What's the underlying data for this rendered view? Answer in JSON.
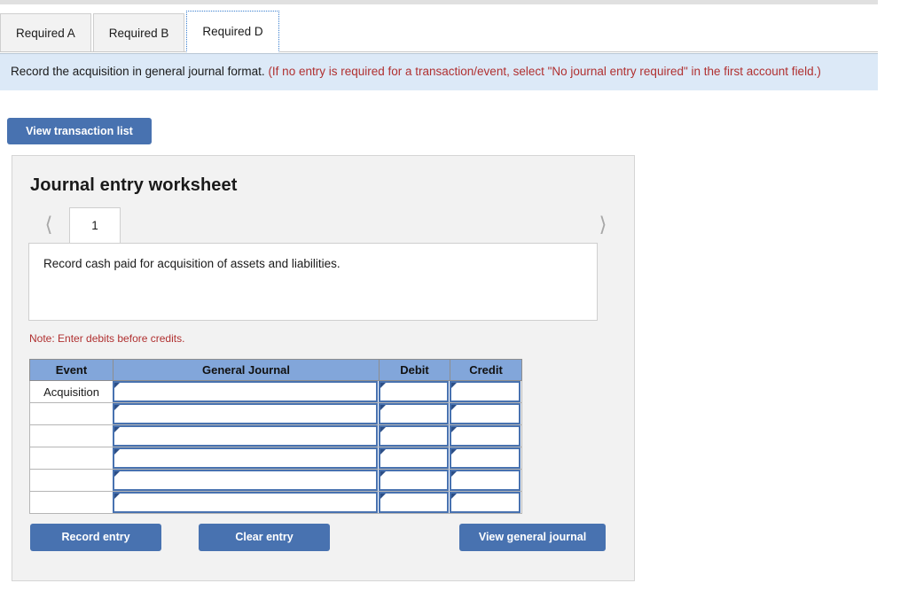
{
  "tabs": [
    {
      "label": "Required A",
      "active": false
    },
    {
      "label": "Required B",
      "active": false
    },
    {
      "label": "Required D",
      "active": true
    }
  ],
  "instruction": {
    "main": "Record the acquisition in general journal format.",
    "hint": "(If no entry is required for a transaction/event, select \"No journal entry required\" in the first account field.)"
  },
  "toolbar": {
    "view_transaction_list_label": "View transaction list"
  },
  "worksheet": {
    "title": "Journal entry worksheet",
    "pager": {
      "prev_icon": "chevron-left-icon",
      "next_icon": "chevron-right-icon",
      "current_page": "1"
    },
    "description": "Record cash paid for acquisition of assets and liabilities.",
    "note": "Note: Enter debits before credits.",
    "table": {
      "headers": [
        "Event",
        "General Journal",
        "Debit",
        "Credit"
      ],
      "rows": [
        {
          "event": "Acquisition",
          "general_journal": "",
          "debit": "",
          "credit": ""
        },
        {
          "event": "",
          "general_journal": "",
          "debit": "",
          "credit": ""
        },
        {
          "event": "",
          "general_journal": "",
          "debit": "",
          "credit": ""
        },
        {
          "event": "",
          "general_journal": "",
          "debit": "",
          "credit": ""
        },
        {
          "event": "",
          "general_journal": "",
          "debit": "",
          "credit": ""
        },
        {
          "event": "",
          "general_journal": "",
          "debit": "",
          "credit": ""
        }
      ]
    },
    "actions": {
      "record_entry_label": "Record entry",
      "clear_entry_label": "Clear entry",
      "view_general_journal_label": "View general journal"
    }
  },
  "colors": {
    "button_blue": "#4872b0",
    "table_header_blue": "#82a6da",
    "instruction_bg": "#dce9f7",
    "note_red": "#b03030",
    "panel_bg": "#f2f2f2",
    "field_border_blue": "#4872b0",
    "field_marker_blue": "#2c4f87"
  }
}
